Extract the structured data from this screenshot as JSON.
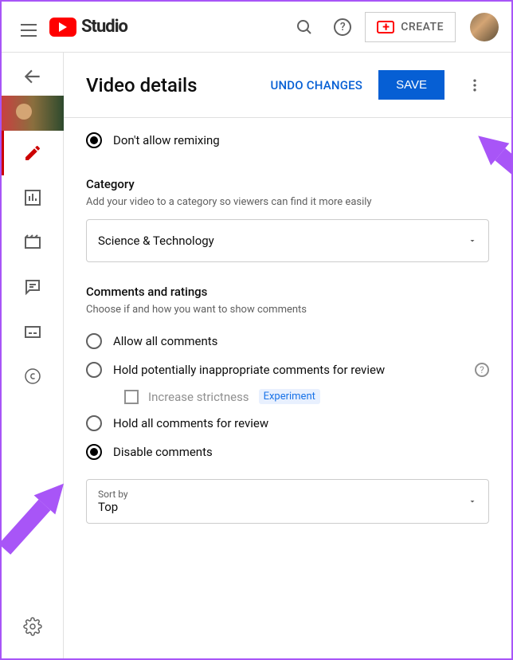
{
  "header": {
    "logo_text": "Studio",
    "create_label": "CREATE"
  },
  "titlebar": {
    "title": "Video details",
    "undo_label": "UNDO CHANGES",
    "save_label": "SAVE"
  },
  "remixing": {
    "dont_allow_label": "Don't allow remixing"
  },
  "category": {
    "heading": "Category",
    "description": "Add your video to a category so viewers can find it more easily",
    "selected": "Science & Technology"
  },
  "comments": {
    "heading": "Comments and ratings",
    "description": "Choose if and how you want to show comments",
    "options": {
      "allow_all": "Allow all comments",
      "hold_inappropriate": "Hold potentially inappropriate comments for review",
      "increase_strictness": "Increase strictness",
      "experiment_badge": "Experiment",
      "hold_all": "Hold all comments for review",
      "disable": "Disable comments"
    },
    "sortby_kicker": "Sort by",
    "sortby_value": "Top"
  }
}
